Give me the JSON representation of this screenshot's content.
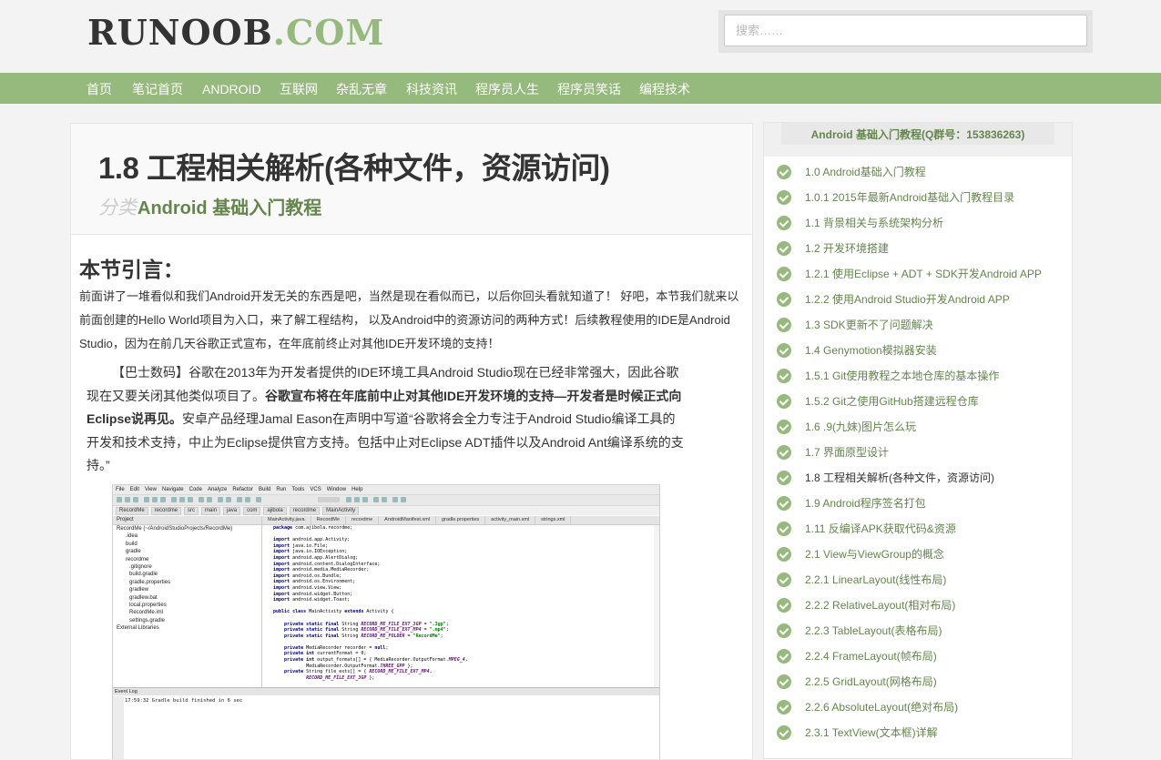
{
  "header": {
    "logo_dark": "RUNOOB",
    "logo_green": ".COM",
    "search_placeholder": "搜索……"
  },
  "nav": [
    "首页",
    "笔记首页",
    "ANDROID",
    "互联网",
    "杂乱无章",
    "科技资讯",
    "程序员人生",
    "程序员笑话",
    "编程技术"
  ],
  "article": {
    "title": "1.8 工程相关解析(各种文件，资源访问)",
    "category_label": "分类",
    "category_link": "Android 基础入门教程",
    "section_title": "本节引言：",
    "intro": "前面讲了一堆看似和我们Android开发无关的东西是吧，当然是现在看似而已，以后你回头看就知道了！ 好吧，本节我们就来以前面创建的Hello World项目为入口，来了解工程结构， 以及Android中的资源访问的两种方式！后续教程使用的IDE是Android Studio，因为在前几天谷歌正式宣布，在年底前终止对其他IDE开发环境的支持！",
    "quote_part1": "【巴士数码】谷歌在2013年为开发者提供的IDE环境工具Android Studio现在已经非常强大，因此谷歌现在又要关闭其他类似项目了。",
    "quote_bold": "谷歌宣布将在年底前中止对其他IDE开发环境的支持—开发者是时候正式向Eclipse说再见。",
    "quote_part2": "安卓产品经理Jamal Eason在声明中写道“谷歌将会全力专注于Android Studio编译工具的开发和技术支持，中止为Eclipse提供官方支持。包括中止对Eclipse ADT插件以及Android Ant编译系统的支持。”"
  },
  "screenshot": {
    "menu": [
      "File",
      "Edit",
      "View",
      "Navigate",
      "Code",
      "Analyze",
      "Refactor",
      "Build",
      "Run",
      "Tools",
      "VCS",
      "Window",
      "Help"
    ],
    "crumbs": [
      "RecordMe",
      "recordme",
      "src",
      "main",
      "java",
      "com",
      "ajibola",
      "recordme",
      "MainActivity"
    ],
    "project_header": "Project",
    "tree": [
      "RecordMe (~/AndroidStudioProjects/RecordMe)",
      ".idea",
      "build",
      "gradle",
      "recordme",
      ".gitignore",
      "build.gradle",
      "gradle.properties",
      "gradlew",
      "gradlew.bat",
      "local.properties",
      "RecordMe.iml",
      "settings.gradle",
      "External Libraries"
    ],
    "tabs": [
      "MainActivity.java",
      "RecordMe",
      "recordme",
      "AndroidManifest.xml",
      "gradle.properties",
      "activity_main.xml",
      "strings.xml"
    ],
    "log_header": "Event Log",
    "log_line": "17:59:32 Gradle build finished in 6 sec"
  },
  "sidebar": {
    "title": "Android 基础入门教程(Q群号：153836263)",
    "items": [
      "1.0 Android基础入门教程",
      "1.0.1 2015年最新Android基础入门教程目录",
      "1.1 背景相关与系统架构分析",
      "1.2 开发环境搭建",
      "1.2.1 使用Eclipse + ADT + SDK开发Android APP",
      "1.2.2 使用Android Studio开发Android APP",
      "1.3 SDK更新不了问题解决",
      "1.4 Genymotion模拟器安装",
      "1.5.1 Git使用教程之本地仓库的基本操作",
      "1.5.2 Git之使用GitHub搭建远程仓库",
      "1.6 .9(九妹)图片怎么玩",
      "1.7 界面原型设计",
      "1.8 工程相关解析(各种文件，资源访问)",
      "1.9 Android程序签名打包",
      "1.11 反编译APK获取代码&资源",
      "2.1 View与ViewGroup的概念",
      "2.2.1 LinearLayout(线性布局)",
      "2.2.2 RelativeLayout(相对布局)",
      "2.2.3 TableLayout(表格布局)",
      "2.2.4 FrameLayout(帧布局)",
      "2.2.5 GridLayout(网格布局)",
      "2.2.6 AbsoluteLayout(绝对布局)",
      "2.3.1 TextView(文本框)详解"
    ],
    "current_index": 12
  },
  "colors": {
    "brand_green": "#96b97d",
    "link_green": "#64854c"
  },
  "icons": {
    "sidebar_item": "check-circle-icon"
  }
}
